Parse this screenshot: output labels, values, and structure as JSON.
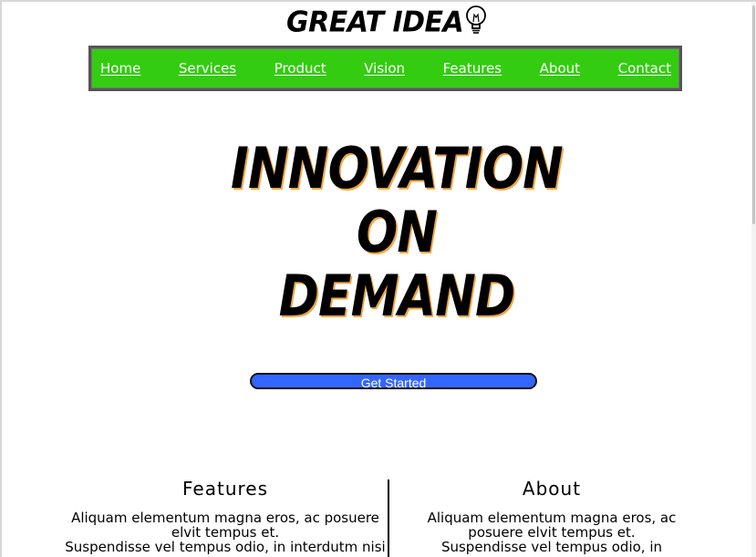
{
  "logo": {
    "text": "GREAT IDEA"
  },
  "nav": {
    "items": [
      "Home",
      "Services",
      "Product",
      "Vision",
      "Features",
      "About",
      "Contact"
    ],
    "background": "#33cc11"
  },
  "hero": {
    "line1": "INNOVATION",
    "line2": "ON",
    "line3": "DEMAND",
    "cta_label": "Get Started",
    "cta_color": "#3366ff"
  },
  "features": {
    "title": "Features",
    "line1": "Aliquam elementum magna eros, ac posuere elvit tempus et.",
    "line2": "Suspendisse vel tempus odio, in interdutm nisi"
  },
  "about": {
    "title": "About",
    "line1": "Aliquam elementum magna eros, ac posuere elvit tempus et.",
    "line2": "Suspendisse vel tempus odio, in"
  },
  "icons": {
    "logo_icon": "lightbulb-icon"
  }
}
